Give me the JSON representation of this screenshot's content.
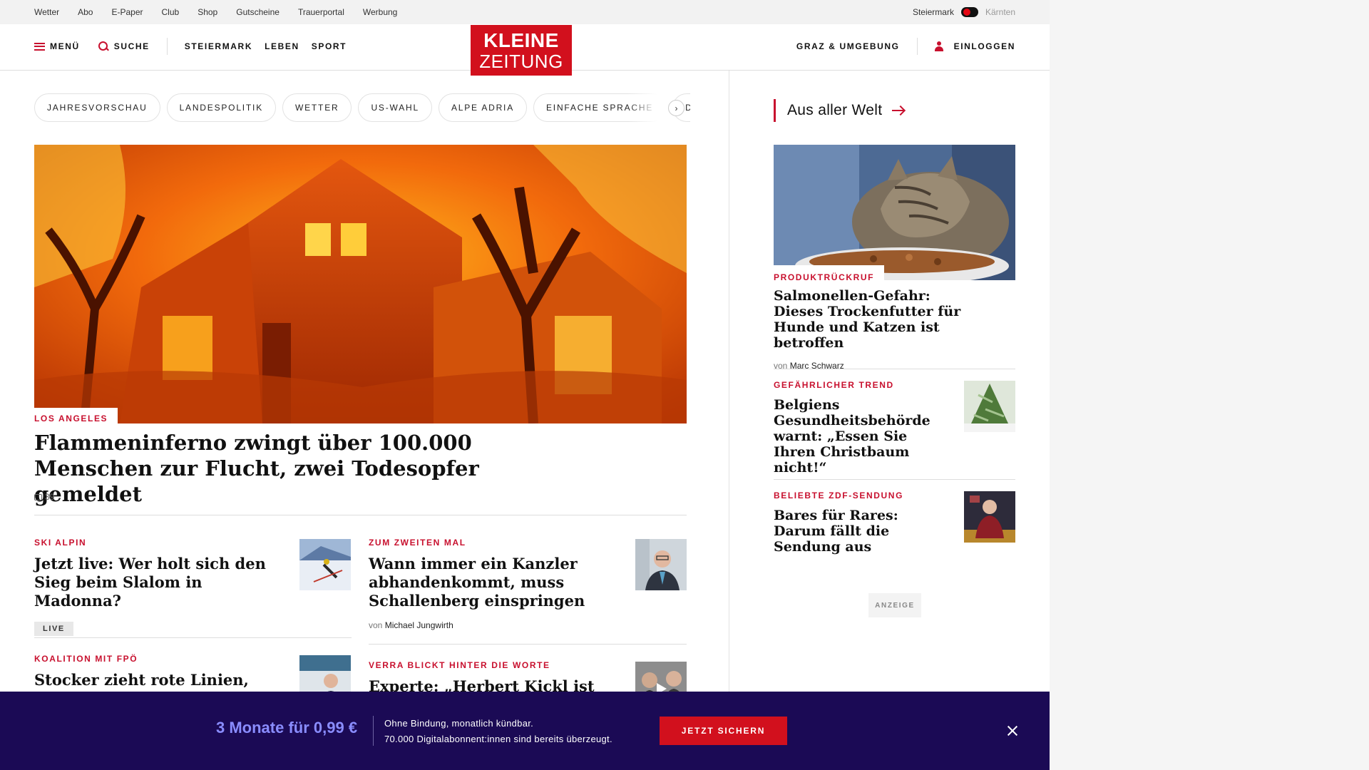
{
  "utility_nav": [
    "Wetter",
    "Abo",
    "E-Paper",
    "Club",
    "Shop",
    "Gutscheine",
    "Trauerportal",
    "Werbung"
  ],
  "region_switch": {
    "active": "Steiermark",
    "inactive": "Kärnten"
  },
  "header": {
    "menu_label": "MENÜ",
    "search_label": "SUCHE",
    "sections": [
      "STEIERMARK",
      "LEBEN",
      "SPORT"
    ],
    "logo_line1": "KLEINE",
    "logo_line2": "ZEITUNG",
    "region_link": "GRAZ & UMGEBUNG",
    "login_label": "EINLOGGEN"
  },
  "topics": [
    "JAHRESVORSCHAU",
    "LANDESPOLITIK",
    "WETTER",
    "US-WAHL",
    "ALPE ADRIA",
    "EINFACHE SPRACHE",
    "DOSSIER"
  ],
  "hero": {
    "kicker": "LOS ANGELES",
    "title": "Flammeninferno zwingt über 100.000 Menschen zur Flucht, zwei Todesopfer gemeldet",
    "comment_count": "39"
  },
  "teasers": [
    {
      "kicker": "SKI ALPIN",
      "title": "Jetzt live: Wer holt sich den Sieg beim Slalom in Madonna?",
      "badge": "LIVE"
    },
    {
      "kicker": "ZUM ZWEITEN MAL",
      "title": "Wann immer ein Kanzler abhandenkommt, muss Schallenberg einspringen",
      "byline_prefix": "von",
      "author": "Michael Jungwirth"
    },
    {
      "kicker": "KOALITION MIT FPÖ",
      "title": "Stocker zieht rote Linien,"
    },
    {
      "kicker": "VERRA BLICKT HINTER DIE WORTE",
      "title": "Experte: „Herbert Kickl ist"
    }
  ],
  "sidebar": {
    "section_title": "Aus aller Welt",
    "lead": {
      "kicker": "PRODUKTRÜCKRUF",
      "title": "Salmonellen-Gefahr: Dieses Trockenfutter für Hunde und Katzen ist betroffen",
      "byline_prefix": "von",
      "author": "Marc Schwarz"
    },
    "items": [
      {
        "kicker": "GEFÄHRLICHER TREND",
        "title": "Belgiens Gesundheitsbehörde warnt: „Essen Sie Ihren Christbaum nicht!“"
      },
      {
        "kicker": "BELIEBTE ZDF-SENDUNG",
        "title": "Bares für Rares: Darum fällt die Sendung aus"
      }
    ],
    "ad_label": "ANZEIGE"
  },
  "promo": {
    "price": "3 Monate für 0,99 €",
    "line1": "Ohne Bindung, monatlich kündbar.",
    "line2": "70.000 Digitalabonnent:innen sind bereits überzeugt.",
    "cta": "JETZT SICHERN"
  },
  "colors": {
    "brand_red": "#d2101d",
    "kicker_red": "#c8102e",
    "promo_bg": "#1b0a55",
    "promo_price": "#8a8dff"
  }
}
